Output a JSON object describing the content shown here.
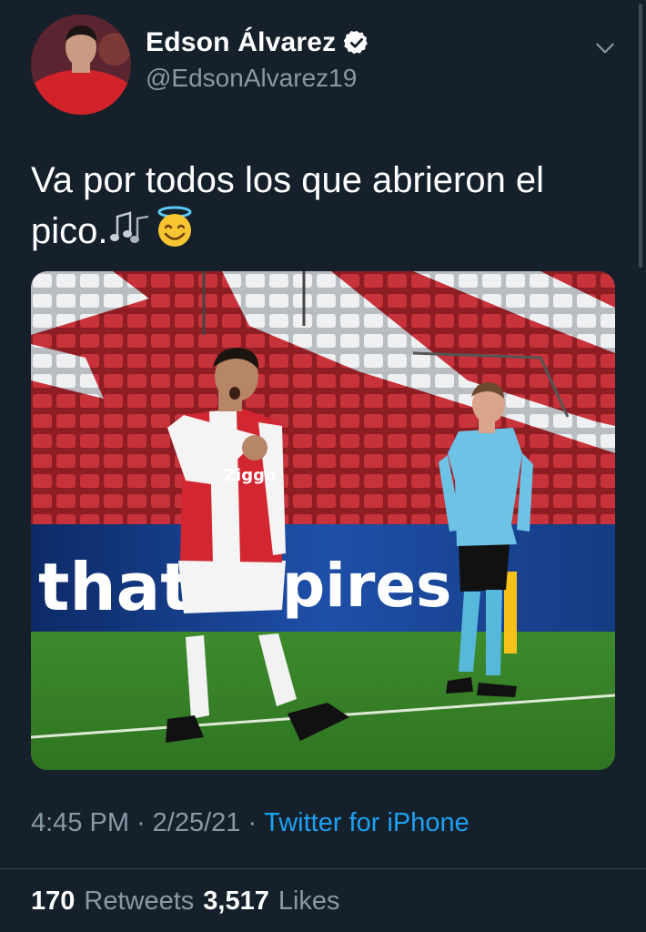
{
  "author": {
    "display_name": "Edson Álvarez",
    "handle": "@EdsonAlvarez19",
    "verified": true
  },
  "tweet": {
    "text": "Va por todos los que abrieron el pico.",
    "emojis": [
      "musical-notes",
      "smiling-face-with-halo"
    ]
  },
  "photo": {
    "banner_text": "that",
    "banner_text_2": "pires",
    "shirt_sponsor": "Ziggo"
  },
  "meta": {
    "time": "4:45 PM",
    "separator": "·",
    "date": "2/25/21",
    "source": "Twitter for iPhone"
  },
  "stats": {
    "retweets_count": "170",
    "retweets_label": "Retweets",
    "likes_count": "3,517",
    "likes_label": "Likes"
  },
  "colors": {
    "background": "#15202b",
    "secondary_text": "#8899a6",
    "link": "#1da1f2"
  }
}
